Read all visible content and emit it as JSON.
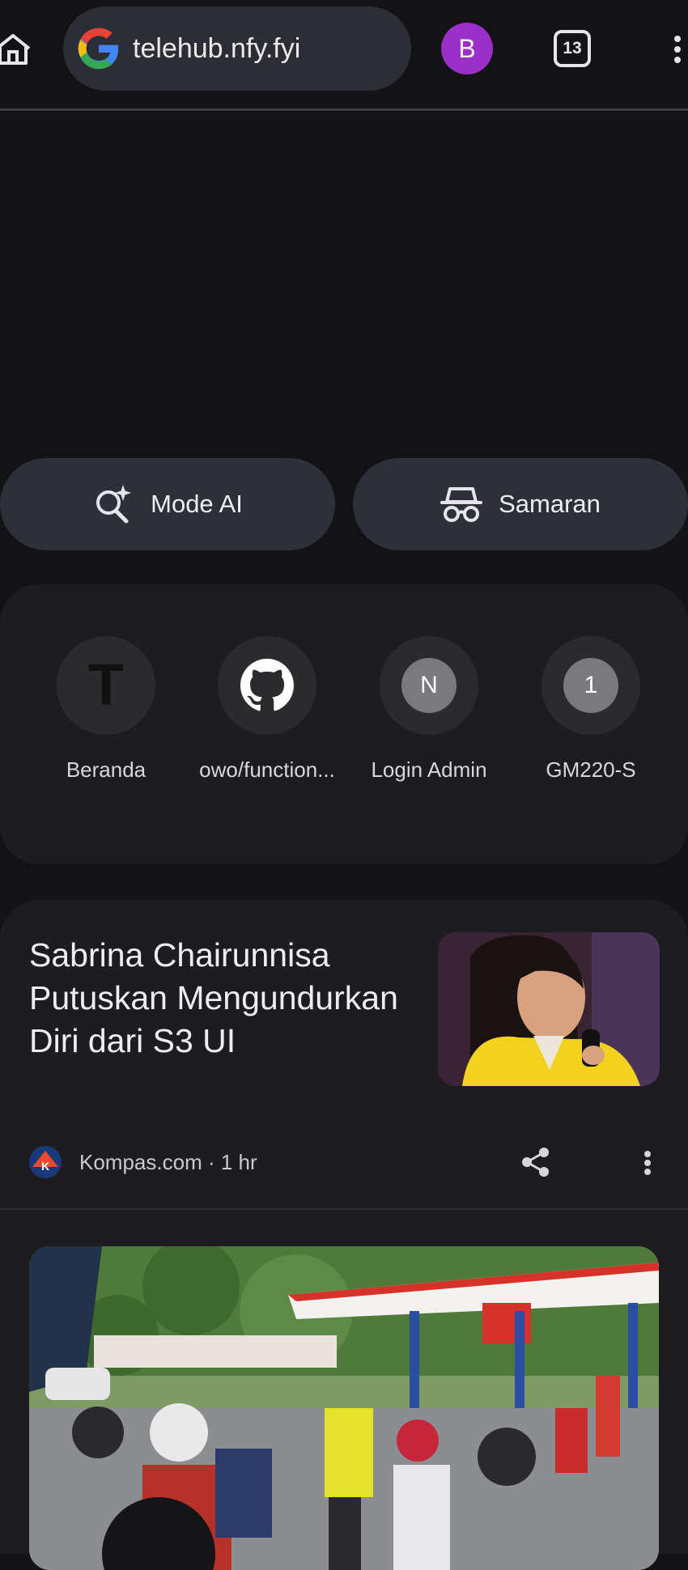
{
  "browser": {
    "url": "telehub.nfy.fyi",
    "profile_initial": "B",
    "tab_count": "13",
    "colors": {
      "profile": "#9c2fc7",
      "background": "#131316"
    },
    "icons": [
      "home-icon",
      "google-logo-icon",
      "more-vert-icon"
    ]
  },
  "chips": {
    "ai_mode": {
      "label": "Mode AI",
      "icon": "ai-search-icon"
    },
    "incognito": {
      "label": "Samaran",
      "icon": "incognito-icon"
    }
  },
  "shortcuts": [
    {
      "label": "Beranda",
      "glyph": "T",
      "icon": "letter-t-icon"
    },
    {
      "label": "owo/function...",
      "icon": "github-icon"
    },
    {
      "label": "Login Admin",
      "glyph": "N",
      "icon": "letter-badge-icon"
    },
    {
      "label": "GM220-S",
      "glyph": "1",
      "icon": "number-badge-icon"
    }
  ],
  "feed": {
    "article1": {
      "headline": "Sabrina Chairunnisa Putuskan Mengundurkan Diri dari S3 UI",
      "source": "Kompas.com · 1 hr",
      "icons": [
        "share-icon",
        "more-vert-icon"
      ]
    }
  }
}
